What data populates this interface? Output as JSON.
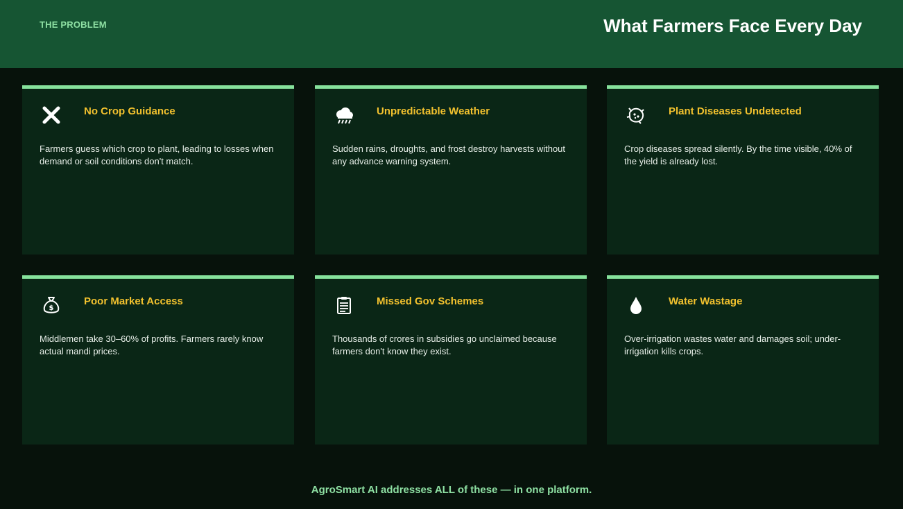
{
  "header": {
    "kicker": "THE PROBLEM",
    "title": "What Farmers Face Every Day"
  },
  "cards": [
    {
      "icon": "cross-mark-icon",
      "title": "No Crop Guidance",
      "text": "Farmers guess which crop to plant, leading to losses when demand or soil conditions don't match."
    },
    {
      "icon": "storm-cloud-icon",
      "title": "Unpredictable Weather",
      "text": "Sudden rains, droughts, and frost destroy harvests without any advance warning system."
    },
    {
      "icon": "microbe-icon",
      "title": "Plant Diseases Undetected",
      "text": "Crop diseases spread silently. By the time visible, 40% of the yield is already lost."
    },
    {
      "icon": "money-bag-icon",
      "title": "Poor Market Access",
      "text": "Middlemen take 30–60% of profits. Farmers rarely know actual mandi prices."
    },
    {
      "icon": "clipboard-icon",
      "title": "Missed Gov Schemes",
      "text": "Thousands of crores in subsidies go unclaimed because farmers don't know they exist."
    },
    {
      "icon": "water-drop-icon",
      "title": "Water Wastage",
      "text": "Over-irrigation wastes water and damages soil; under-irrigation kills crops."
    }
  ],
  "footer": {
    "text": "AgroSmart AI addresses ALL of these — in one platform."
  },
  "colors": {
    "header_bg": "#165533",
    "page_bg": "#07120b",
    "card_bg": "#0a2616",
    "card_accent": "#86e29c",
    "card_title": "#f2c12e",
    "kicker": "#8ee0a3"
  }
}
